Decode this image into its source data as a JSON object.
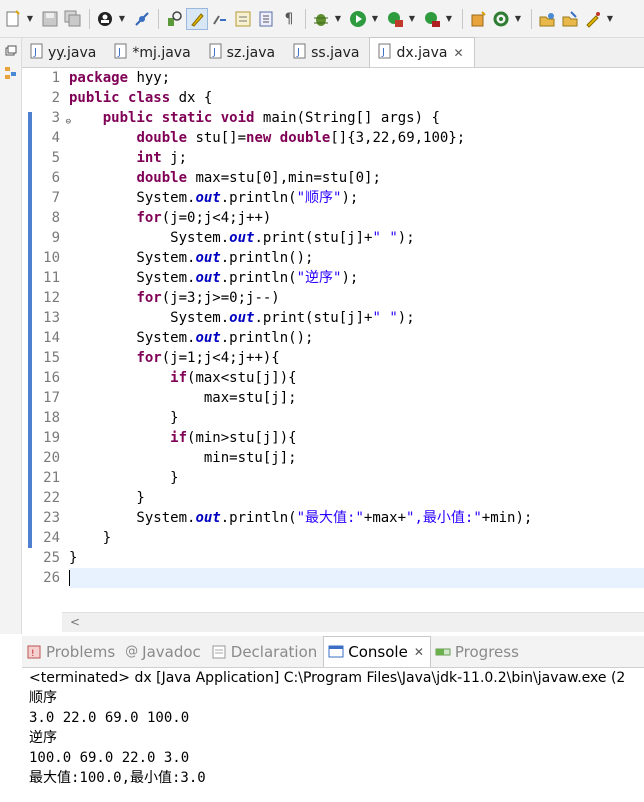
{
  "toolbar": {
    "icons": [
      "new-icon",
      "save-icon",
      "save-all-icon",
      "manage-icon",
      "skip-breakpoints-icon",
      "open-type-icon",
      "mark-occurrences-icon",
      "toggle-block-icon",
      "show-whitespace-icon",
      "pilcrow-icon",
      "debug-icon",
      "run-icon",
      "coverage-icon",
      "run-external-icon",
      "new-class-icon",
      "refresh-icon",
      "open-task-icon",
      "perspective-icon",
      "search-icon"
    ]
  },
  "editor": {
    "tabs": [
      {
        "label": "yy.java",
        "active": false
      },
      {
        "label": "*mj.java",
        "active": false
      },
      {
        "label": "sz.java",
        "active": false
      },
      {
        "label": "ss.java",
        "active": false
      },
      {
        "label": "dx.java",
        "active": true
      }
    ],
    "line_numbers": [
      "1",
      "2",
      "3",
      "4",
      "5",
      "6",
      "7",
      "8",
      "9",
      "10",
      "11",
      "12",
      "13",
      "14",
      "15",
      "16",
      "17",
      "18",
      "19",
      "20",
      "21",
      "22",
      "23",
      "24",
      "25",
      "26"
    ],
    "lines": [
      "package hyy;",
      "public class dx {",
      "    public static void main(String[] args) {",
      "        double stu[]=new double[]{3,22,69,100};",
      "        int j;",
      "        double max=stu[0],min=stu[0];",
      "        System.out.println(\"顺序\");",
      "        for(j=0;j<4;j++)",
      "            System.out.print(stu[j]+\" \");",
      "        System.out.println();",
      "        System.out.println(\"逆序\");",
      "        for(j=3;j>=0;j--)",
      "            System.out.print(stu[j]+\" \");",
      "        System.out.println();",
      "        for(j=1;j<4;j++){",
      "            if(max<stu[j]){",
      "                max=stu[j];",
      "            }",
      "            if(min>stu[j]){",
      "                min=stu[j];",
      "            }",
      "        }",
      "        System.out.println(\"最大值:\"+max+\",最小值:\"+min);",
      "    }",
      "}",
      ""
    ],
    "current_line": 26
  },
  "panel": {
    "tabs": [
      {
        "label": "Problems",
        "icon": "problems-icon",
        "active": false
      },
      {
        "label": "Javadoc",
        "icon": "javadoc-icon",
        "active": false
      },
      {
        "label": "Declaration",
        "icon": "declaration-icon",
        "active": false
      },
      {
        "label": "Console",
        "icon": "console-icon",
        "active": true
      },
      {
        "label": "Progress",
        "icon": "progress-icon",
        "active": false
      }
    ],
    "console": {
      "header": "<terminated> dx [Java Application] C:\\Program Files\\Java\\jdk-11.0.2\\bin\\javaw.exe (2",
      "output": [
        "顺序",
        "3.0 22.0 69.0 100.0 ",
        "逆序",
        "100.0 69.0 22.0 3.0 ",
        "最大值:100.0,最小值:3.0"
      ]
    }
  },
  "colors": {
    "keyword": "#7f0055",
    "string": "#2a00ff",
    "field": "#0000c0",
    "current_line": "#e8f2fe",
    "annotation_bar": "#4f7fcf"
  }
}
